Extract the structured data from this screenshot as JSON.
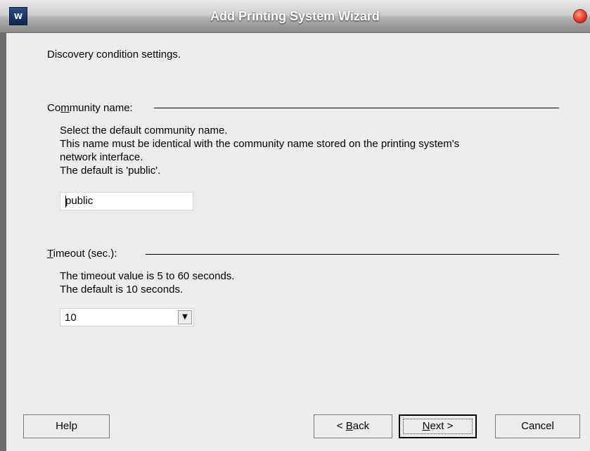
{
  "window": {
    "title": "Add Printing System Wizard",
    "icon": "printer-app-icon"
  },
  "intro": "Discovery condition settings.",
  "community": {
    "heading_pre": "Co",
    "heading_mnemonic": "m",
    "heading_post": "munity name:",
    "desc1": "Select the default community name.",
    "desc2": "This name must be identical with the community name stored on the printing system's",
    "desc3": "network interface.",
    "desc4": "The default is 'public'.",
    "value": "public"
  },
  "timeout": {
    "heading_mnemonic": "T",
    "heading_post": "imeout (sec.):",
    "desc1": "The timeout value is 5 to 60 seconds.",
    "desc2": "The default is 10 seconds.",
    "selected": "10"
  },
  "buttons": {
    "help": "Help",
    "back_pre": "< ",
    "back_mnemonic": "B",
    "back_post": "ack",
    "next_mnemonic": "N",
    "next_post": "ext >",
    "cancel": "Cancel"
  }
}
